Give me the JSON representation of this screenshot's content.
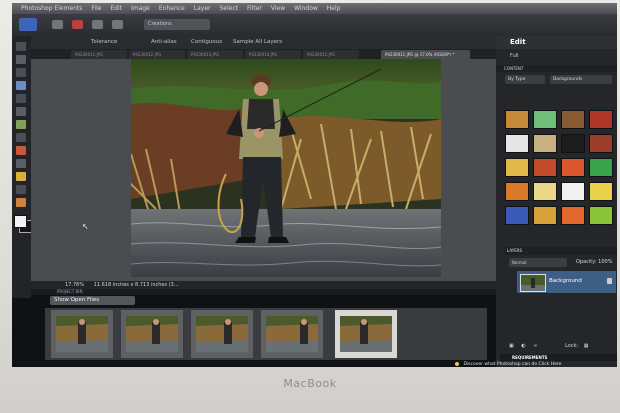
{
  "menubar": {
    "items": [
      "Photoshop Elements",
      "File",
      "Edit",
      "Image",
      "Enhance",
      "Layer",
      "Select",
      "Filter",
      "View",
      "Window",
      "Help"
    ]
  },
  "titlebar": {
    "search_placeholder": "Creations"
  },
  "options_bar": {
    "items": [
      "Tolerance",
      "Anti-alias",
      "Contiguous",
      "Sample All Layers"
    ]
  },
  "document_tabs": [
    {
      "label": "P4230011.JPG"
    },
    {
      "label": "P4230012.JPG"
    },
    {
      "label": "P4230013.JPG"
    },
    {
      "label": "P4230014.JPG"
    },
    {
      "label": "P4230015.JPG"
    },
    {
      "label": "P4230011.JPG @ 17.6% (RGB/8*) *",
      "active": true
    }
  ],
  "statusbar": {
    "zoom": "17.76%",
    "size": "11.618 inches x 8.713 inches (3..."
  },
  "project_bin": {
    "title": "PROJECT BIN",
    "select_value": "Show Open Files"
  },
  "panel": {
    "title": "Edit",
    "subtitle": "Full",
    "content_header": "CONTENT",
    "filter_label": "By Type",
    "type_label": "Backgrounds",
    "layers_header": "LAYERS",
    "blend_mode": "Normal",
    "opacity_label": "Opacity:",
    "opacity_value": "100%",
    "layer_name": "Background",
    "lock_label": "Lock:",
    "requirements_header": "REQUIREMENTS",
    "tip_text": "Discover what Photoshop can do Click Here"
  },
  "colors": {
    "panel_accent": "#3d5f86",
    "app_background": "#101114"
  },
  "brand": "MacBook"
}
